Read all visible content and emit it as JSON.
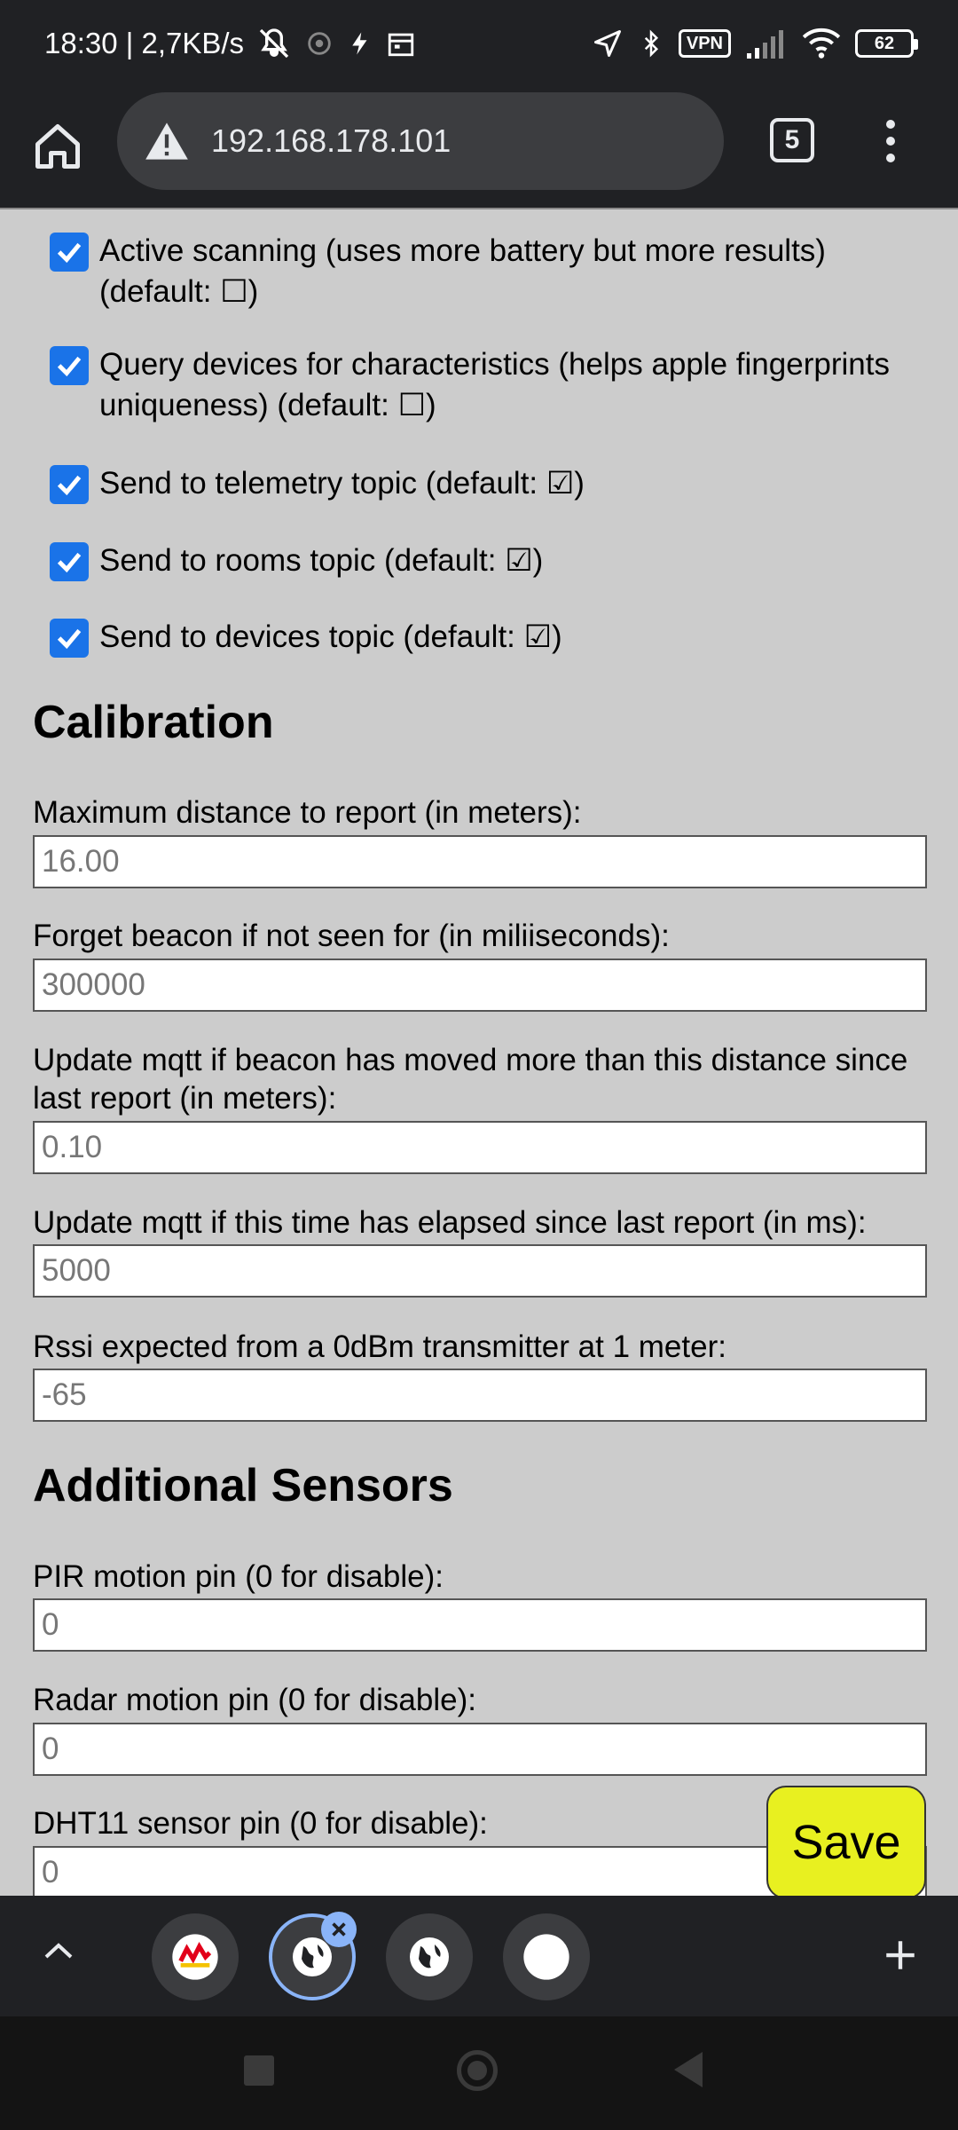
{
  "status_bar": {
    "time_speed": "18:30 | 2,7KB/s",
    "vpn": "VPN",
    "battery": "62"
  },
  "browser": {
    "url": "192.168.178.101",
    "tab_count": "5"
  },
  "checkboxes": [
    {
      "label": "Active scanning (uses more battery but more results) (default: ☐)",
      "checked": true
    },
    {
      "label": "Query devices for characteristics (helps apple fingerprints uniqueness) (default: ☐)",
      "checked": true
    },
    {
      "label": "Send to telemetry topic (default: ☑)",
      "checked": true
    },
    {
      "label": "Send to rooms topic (default: ☑)",
      "checked": true
    },
    {
      "label": "Send to devices topic (default: ☑)",
      "checked": true
    }
  ],
  "calibration": {
    "title": "Calibration",
    "fields": [
      {
        "label": "Maximum distance to report (in meters):",
        "placeholder": "16.00"
      },
      {
        "label": "Forget beacon if not seen for (in miliiseconds):",
        "placeholder": "300000"
      },
      {
        "label": "Update mqtt if beacon has moved more than this distance since last report (in meters):",
        "placeholder": "0.10"
      },
      {
        "label": "Update mqtt if this time has elapsed since last report (in ms):",
        "placeholder": "5000"
      },
      {
        "label": "Rssi expected from a 0dBm transmitter at 1 meter:",
        "placeholder": "-65"
      }
    ]
  },
  "sensors": {
    "title": "Additional Sensors",
    "fields": [
      {
        "label": "PIR motion pin (0 for disable):",
        "placeholder": "0"
      },
      {
        "label": "Radar motion pin (0 for disable):",
        "placeholder": "0"
      },
      {
        "label": "DHT11 sensor pin (0 for disable):",
        "placeholder": "0"
      }
    ]
  },
  "save_label": "Save",
  "colors": {
    "checkbox": "#1a73e8",
    "save_button": "#e8f020",
    "page_background": "#cccccc",
    "browser_chrome": "#202124"
  }
}
